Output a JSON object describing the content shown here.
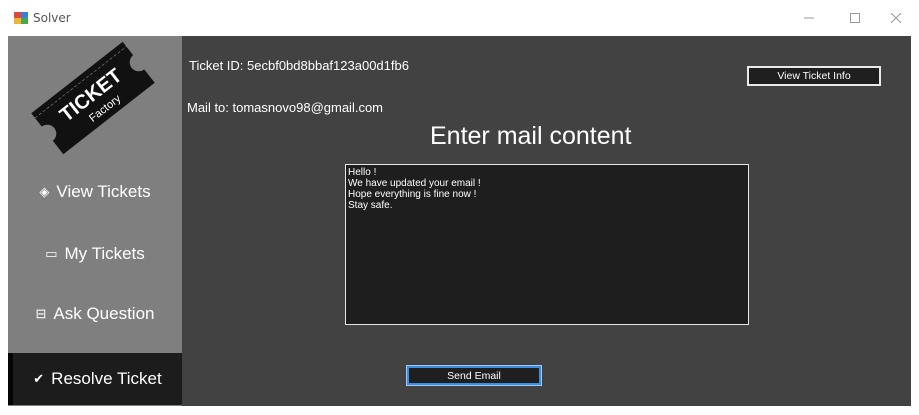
{
  "window": {
    "title": "Solver",
    "min_glyph": "—",
    "max_glyph": "☐",
    "close_glyph": "✕"
  },
  "logo": {
    "line1": "TICKET",
    "line2": "Factory"
  },
  "sidebar": {
    "items": [
      {
        "label": "View Tickets",
        "icon": "eye-icon",
        "glyph": "◈"
      },
      {
        "label": "My Tickets",
        "icon": "ticket-icon",
        "glyph": "▭"
      },
      {
        "label": "Ask Question",
        "icon": "inbox-icon",
        "glyph": "⊟"
      },
      {
        "label": "Resolve Ticket",
        "icon": "check-icon",
        "glyph": "✔"
      }
    ],
    "active_index": 3
  },
  "content": {
    "ticket_id": "Ticket ID: 5ecbf0bd8bbaf123a00d1fb6",
    "mail_to": "Mail to: tomasnovo98@gmail.com",
    "heading": "Enter mail content",
    "view_info_label": "View Ticket Info",
    "mail_body": "Hello !\nWe have updated your email !\nHope everything is fine now !\nStay safe.",
    "send_label": "Send Email"
  },
  "colors": {
    "background": "#424242",
    "sidebar": "#7f7f7f",
    "active_nav": "#1c1c1c",
    "focus_border": "#3c8fe0"
  }
}
